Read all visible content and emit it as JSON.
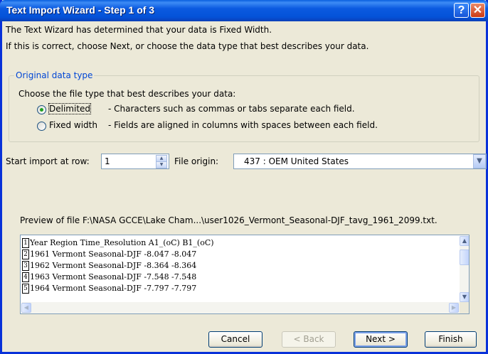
{
  "window": {
    "title": "Text Import Wizard - Step 1 of 3",
    "help_glyph": "?",
    "close_glyph": "✕"
  },
  "intro": {
    "line1": "The Text Wizard has determined that your data is Fixed Width.",
    "line2": "If this is correct, choose Next, or choose the data type that best describes your data."
  },
  "data_type": {
    "group_label": "Original data type",
    "prompt": "Choose the file type that best describes your data:",
    "options": [
      {
        "label": "Delimited",
        "description": "- Characters such as commas or tabs separate each field.",
        "selected": true
      },
      {
        "label": "Fixed width",
        "description": "- Fields are aligned in columns with spaces between each field.",
        "selected": false
      }
    ]
  },
  "import": {
    "start_row_label": "Start import at row:",
    "start_row_value": "1",
    "file_origin_label": "File origin:",
    "file_origin_value": "437 : OEM United States"
  },
  "preview": {
    "label": "Preview of file F:\\NASA GCCE\\Lake Cham...\\user1026_Vermont_Seasonal-DJF_tavg_1961_2099.txt.",
    "rows": [
      {
        "num": "1",
        "text": "Year Region Time_Resolution A1_(oC) B1_(oC)"
      },
      {
        "num": "2",
        "text": "1961 Vermont Seasonal-DJF -8.047 -8.047"
      },
      {
        "num": "3",
        "text": "1962 Vermont Seasonal-DJF -8.364 -8.364"
      },
      {
        "num": "4",
        "text": "1963 Vermont Seasonal-DJF -7.548 -7.548"
      },
      {
        "num": "5",
        "text": "1964 Vermont Seasonal-DJF -7.797 -7.797"
      }
    ]
  },
  "buttons": {
    "cancel": "Cancel",
    "back": "< Back",
    "next": "Next >",
    "finish": "Finish"
  },
  "colors": {
    "titlebar": "#0a5fde",
    "window_bg": "#ece9d8",
    "group_label": "#0046d5",
    "radio_selected": "#21a121"
  }
}
